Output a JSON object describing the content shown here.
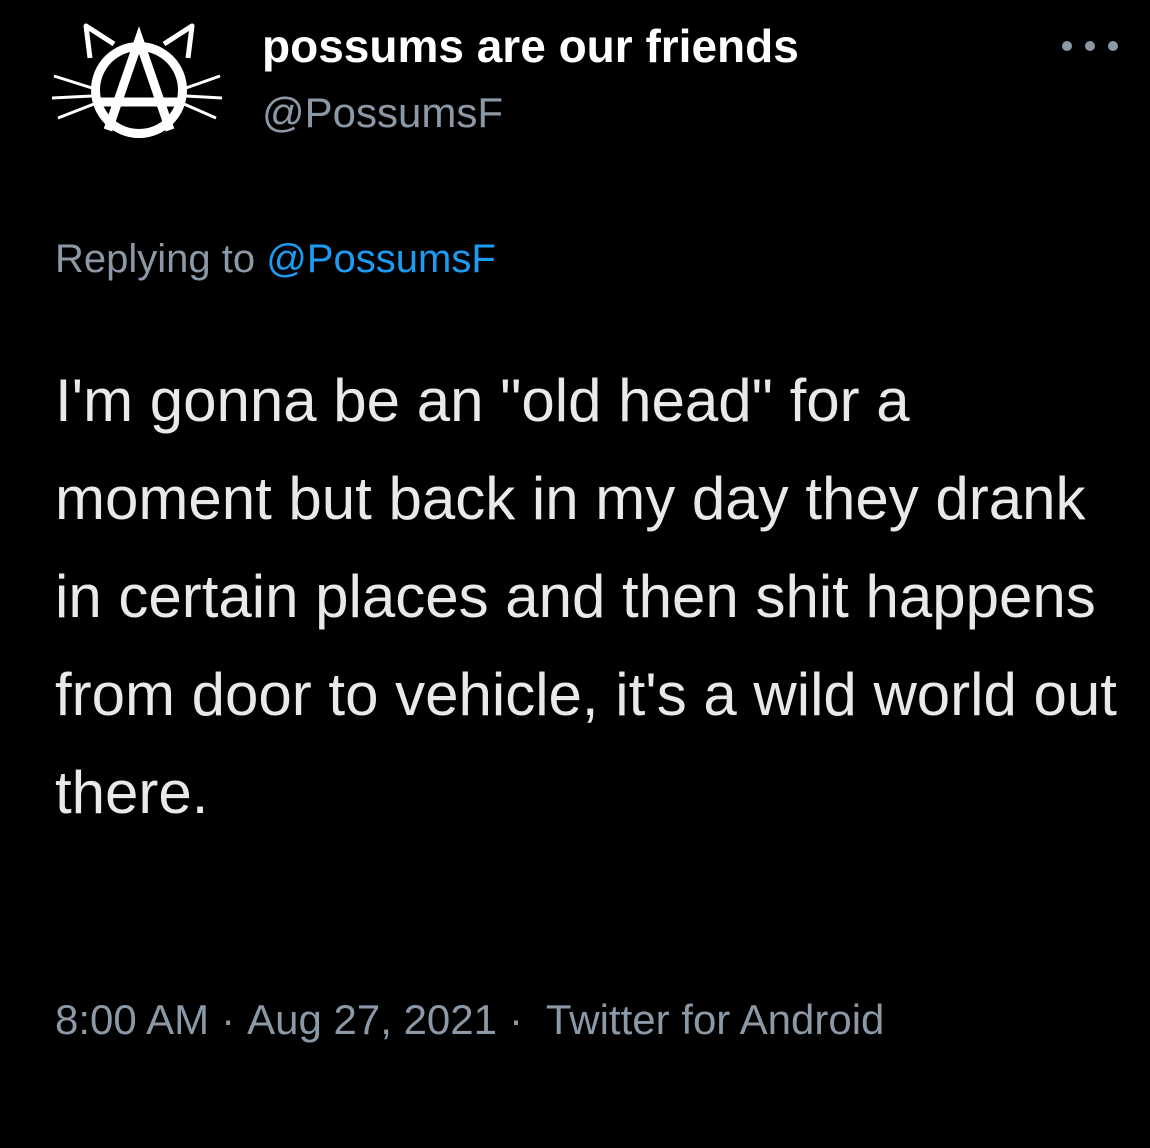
{
  "tweet": {
    "author": {
      "display_name": "possums are our friends",
      "handle": "@PossumsF",
      "avatar_icon": "anarchist-cat-logo"
    },
    "more_icon": "more-horizontal-icon",
    "replying_to_prefix": "Replying to",
    "replying_to_handle": "@PossumsF",
    "text": "I'm gonna be an \"old head\" for a moment but back in my day they drank in certain places and then shit happens from door to vehicle, it's a wild world out there.",
    "time": "8:00 AM",
    "date": "Aug 27, 2021",
    "separator": "·",
    "source": "Twitter for Android"
  },
  "colors": {
    "background": "#000000",
    "primary_text": "#e7e9ea",
    "secondary_text": "#8b98a5",
    "link": "#1d9bf0"
  }
}
